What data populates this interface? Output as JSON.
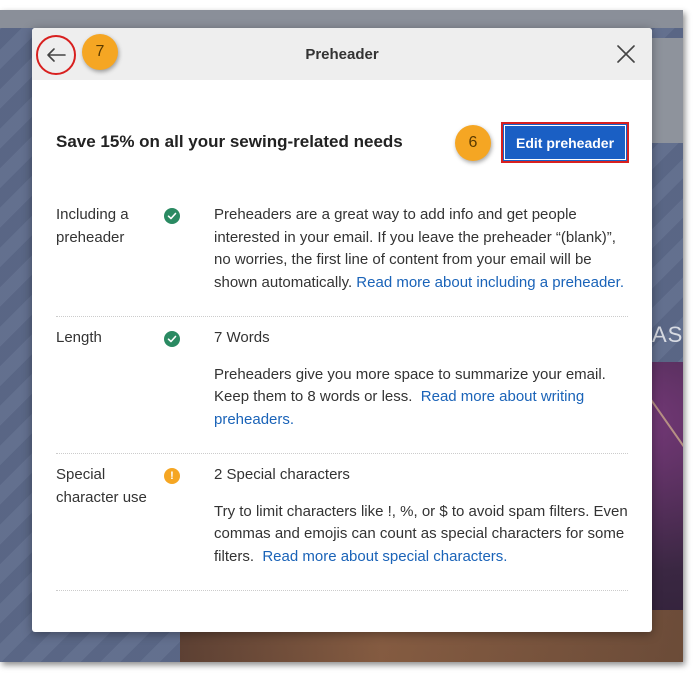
{
  "modal": {
    "title": "Preheader",
    "subject_line": "Save 15% on all your sewing-related needs",
    "edit_button_label": "Edit preheader"
  },
  "annotations": {
    "badge_back": "7",
    "badge_edit": "6"
  },
  "background": {
    "text_fragment": "AS"
  },
  "checks": [
    {
      "label_line1": "Including a",
      "label_line2": "preheader",
      "status": "ok",
      "body": "Preheaders are a great way to add info and get people interested in your email. If you leave the preheader “(blank)”, no worries, the first line of content from your email will be shown automatically. ",
      "link": "Read more about including a preheader."
    },
    {
      "label_line1": "Length",
      "label_line2": "",
      "status": "ok",
      "result": "7 Words",
      "body": "Preheaders give you more space to summarize your email. Keep them to 8 words or less.  ",
      "link": "Read more about writing preheaders."
    },
    {
      "label_line1": "Special",
      "label_line2": "character use",
      "status": "warning",
      "status_glyph": "!",
      "result": "2 Special characters",
      "body": "Try to limit characters like !, %, or $ to avoid spam filters. Even commas and emojis can count as special characters for some filters.  ",
      "link": "Read more about special characters."
    }
  ],
  "colors": {
    "accent_blue": "#1a5fc4",
    "link_blue": "#1a63b8",
    "ok_green": "#2a8a62",
    "warning_orange": "#f5a623",
    "highlight_red": "#d8201f"
  }
}
